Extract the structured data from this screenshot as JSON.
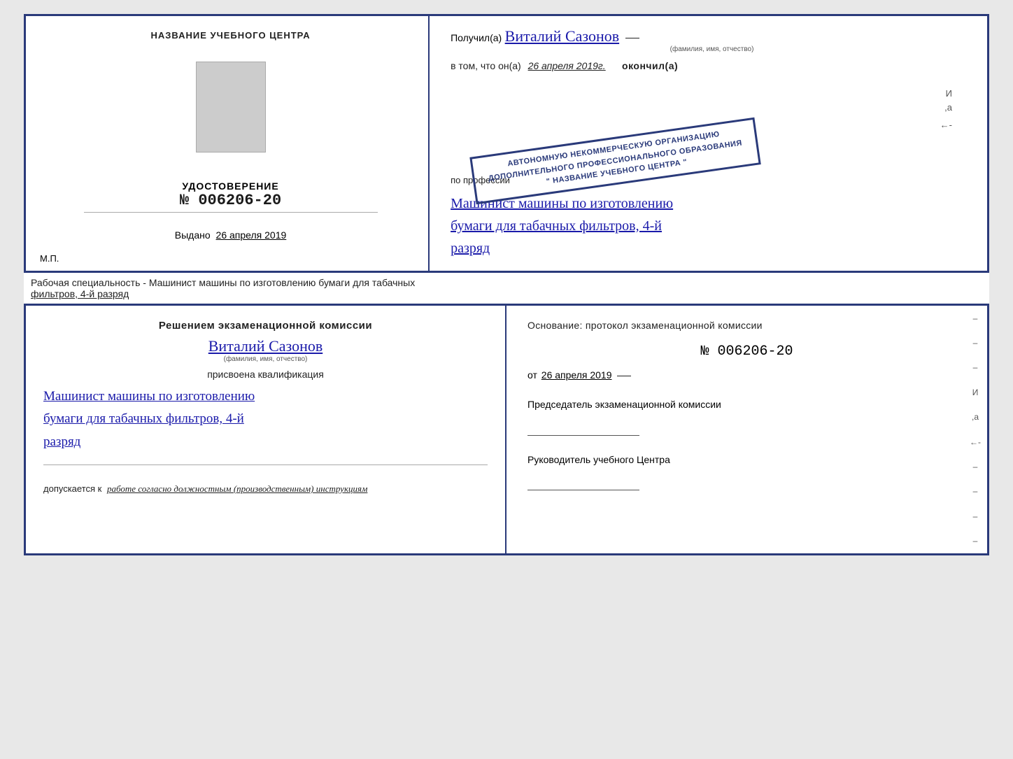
{
  "top_cert": {
    "left": {
      "center_title": "НАЗВАНИЕ УЧЕБНОГО ЦЕНТРА",
      "doc_label": "УДОСТОВЕРЕНИЕ",
      "doc_number": "№ 006206-20",
      "issued_label": "Выдано",
      "issued_date": "26 апреля 2019",
      "mp_label": "М.П."
    },
    "right": {
      "received_prefix": "Получил(а)",
      "recipient_name": "Виталий Сазонов",
      "fio_subtitle": "(фамилия, имя, отчество)",
      "in_that_prefix": "в том, что он(а)",
      "date_handwritten": "26 апреля 2019г.",
      "finished_label": "окончил(а)",
      "stamp_line1": "АВТОНОМНУЮ НЕКОММЕРЧЕСКУЮ ОРГАНИЗАЦИЮ",
      "stamp_line2": "ДОПОЛНИТЕЛЬНОГО ПРОФЕССИОНАЛЬНОГО ОБРАЗОВАНИЯ",
      "stamp_line3": "\" НАЗВАНИЕ УЧЕБНОГО ЦЕНТРА \"",
      "profession_label": "по профессии",
      "profession_text": "Машинист машины по изготовлению бумаги для табачных фильтров, 4-й разряд",
      "profession_line1": "Машинист машины по изготовлению",
      "profession_line2": "бумаги для табачных фильтров, 4-й",
      "profession_line3": "разряд"
    }
  },
  "label_bar": {
    "text_normal": "Рабочая специальность - Машинист машины по изготовлению бумаги для табачных",
    "text_underline": "фильтров, 4-й разряд"
  },
  "bottom_cert": {
    "left": {
      "commission_title": "Решением экзаменационной комиссии",
      "person_name": "Виталий Сазонов",
      "fio_subtitle": "(фамилия, имя, отчество)",
      "qualification_label": "присвоена квалификация",
      "qualification_line1": "Машинист машины по изготовлению",
      "qualification_line2": "бумаги для табачных фильтров, 4-й",
      "qualification_line3": "разряд",
      "allowed_prefix": "допускается к",
      "allowed_text": "работе согласно должностным (производственным) инструкциям"
    },
    "right": {
      "basis_label": "Основание: протокол экзаменационной комиссии",
      "protocol_number": "№ 006206-20",
      "date_prefix": "от",
      "date_value": "26 апреля 2019",
      "chairman_label": "Председатель экзаменационной комиссии",
      "director_label": "Руководитель учебного Центра"
    }
  }
}
